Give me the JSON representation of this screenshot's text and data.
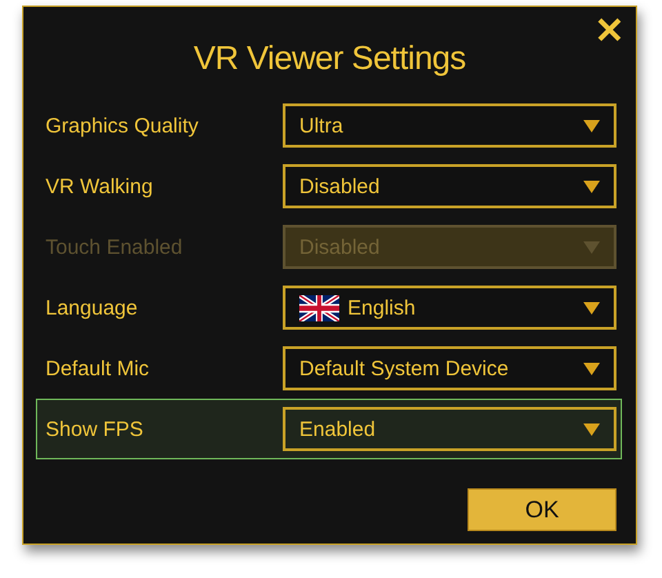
{
  "dialog": {
    "title": "VR Viewer Settings",
    "close_icon": "✕",
    "settings": [
      {
        "label": "Graphics Quality",
        "value": "Ultra",
        "kind": "select",
        "disabled": false,
        "selected": false
      },
      {
        "label": "VR Walking",
        "value": "Disabled",
        "kind": "select",
        "disabled": false,
        "selected": false
      },
      {
        "label": "Touch Enabled",
        "value": "Disabled",
        "kind": "select",
        "disabled": true,
        "selected": false
      },
      {
        "label": "Language",
        "value": "English",
        "kind": "flag-select",
        "disabled": false,
        "selected": false
      },
      {
        "label": "Default Mic",
        "value": "Default System Device",
        "kind": "select",
        "disabled": false,
        "selected": false
      },
      {
        "label": "Show FPS",
        "value": "Enabled",
        "kind": "select",
        "disabled": false,
        "selected": true
      }
    ],
    "ok_button": "OK"
  }
}
